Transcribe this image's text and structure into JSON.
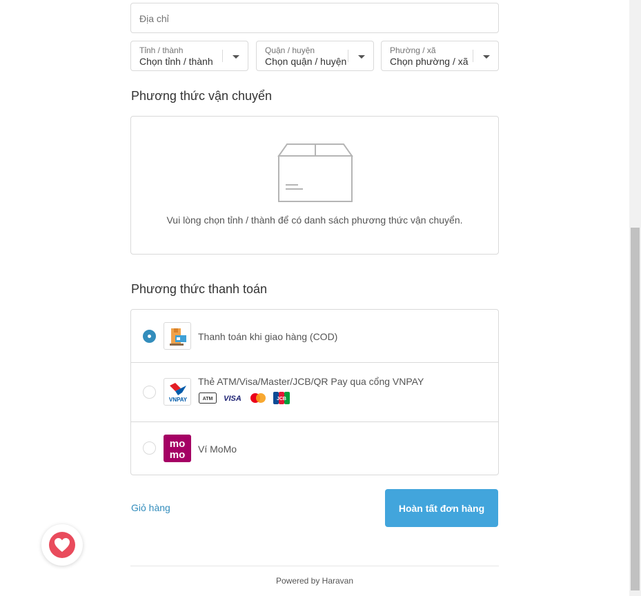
{
  "address": {
    "placeholder": "Địa chỉ"
  },
  "selects": {
    "province": {
      "label": "Tỉnh / thành",
      "value": "Chọn tỉnh / thành"
    },
    "district": {
      "label": "Quận / huyện",
      "value": "Chọn quận / huyện"
    },
    "ward": {
      "label": "Phường / xã",
      "value": "Chọn phường / xã"
    }
  },
  "shipping": {
    "title": "Phương thức vận chuyển",
    "empty_message": "Vui lòng chọn tỉnh / thành để có danh sách phương thức vận chuyển."
  },
  "payment": {
    "title": "Phương thức thanh toán",
    "methods": [
      {
        "label": "Thanh toán khi giao hàng (COD)",
        "selected": true,
        "icon": "cod-icon"
      },
      {
        "label": "Thẻ ATM/Visa/Master/JCB/QR Pay qua cổng VNPAY",
        "selected": false,
        "icon": "vnpay-logo",
        "cards": [
          "ATM",
          "VISA",
          "mastercard",
          "JCB"
        ],
        "logo_text": "VNPAY"
      },
      {
        "label": "Ví MoMo",
        "selected": false,
        "icon": "momo-logo",
        "logo_text": [
          "mo",
          "mo"
        ]
      }
    ]
  },
  "actions": {
    "cart_link": "Giỏ hàng",
    "submit_label": "Hoàn tất đơn hàng"
  },
  "footer": {
    "powered_by": "Powered by Haravan"
  },
  "colors": {
    "accent": "#338dbc",
    "button": "#42a5dc",
    "momo": "#a50064",
    "heart": "#e94b5c"
  }
}
